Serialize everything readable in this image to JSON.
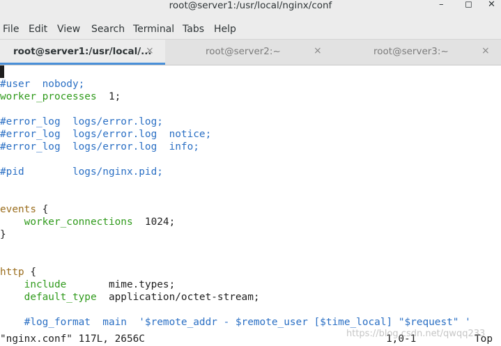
{
  "window": {
    "title": "root@server1:/usr/local/nginx/conf",
    "minimize": "–",
    "maximize": "◻",
    "close": "✕"
  },
  "menu": [
    "File",
    "Edit",
    "View",
    "Search",
    "Terminal",
    "Tabs",
    "Help"
  ],
  "tabs": [
    {
      "label": "root@server1:/usr/local/...",
      "close": "×",
      "active": true
    },
    {
      "label": "root@server2:~",
      "close": "×",
      "active": false
    },
    {
      "label": "root@server3:~",
      "close": "×",
      "active": false
    }
  ],
  "editor": {
    "lines": [
      {
        "row": 1,
        "parts": [
          {
            "t": "#user  nobody;",
            "c": "cm"
          }
        ]
      },
      {
        "row": 2,
        "parts": [
          {
            "t": "worker_processes",
            "c": "dr"
          },
          {
            "t": "  1;",
            "c": ""
          }
        ]
      },
      {
        "row": 4,
        "parts": [
          {
            "t": "#error_log  logs/error.log;",
            "c": "cm"
          }
        ]
      },
      {
        "row": 5,
        "parts": [
          {
            "t": "#error_log  logs/error.log  notice;",
            "c": "cm"
          }
        ]
      },
      {
        "row": 6,
        "parts": [
          {
            "t": "#error_log  logs/error.log  info;",
            "c": "cm"
          }
        ]
      },
      {
        "row": 8,
        "parts": [
          {
            "t": "#pid        logs/nginx.pid;",
            "c": "cm"
          }
        ]
      },
      {
        "row": 11,
        "parts": [
          {
            "t": "events",
            "c": "kw"
          },
          {
            "t": " {",
            "c": ""
          }
        ]
      },
      {
        "row": 12,
        "parts": [
          {
            "t": "    ",
            "c": ""
          },
          {
            "t": "worker_connections",
            "c": "dr"
          },
          {
            "t": "  1024;",
            "c": ""
          }
        ]
      },
      {
        "row": 13,
        "parts": [
          {
            "t": "}",
            "c": ""
          }
        ]
      },
      {
        "row": 16,
        "parts": [
          {
            "t": "http",
            "c": "kw"
          },
          {
            "t": " {",
            "c": ""
          }
        ]
      },
      {
        "row": 17,
        "parts": [
          {
            "t": "    ",
            "c": ""
          },
          {
            "t": "include",
            "c": "dr"
          },
          {
            "t": "       mime.types;",
            "c": ""
          }
        ]
      },
      {
        "row": 18,
        "parts": [
          {
            "t": "    ",
            "c": ""
          },
          {
            "t": "default_type",
            "c": "dr"
          },
          {
            "t": "  application/octet-stream;",
            "c": ""
          }
        ]
      },
      {
        "row": 20,
        "parts": [
          {
            "t": "    ",
            "c": ""
          },
          {
            "t": "#log_format  main  '$remote_addr - $remote_user [$time_local] \"$request\" '",
            "c": "cm"
          }
        ]
      }
    ]
  },
  "status": {
    "file_info": "\"nginx.conf\" 117L, 2656C",
    "position": "1,0-1",
    "scroll": "Top"
  },
  "watermark": "https://blog.csdn.net/qwqq233"
}
